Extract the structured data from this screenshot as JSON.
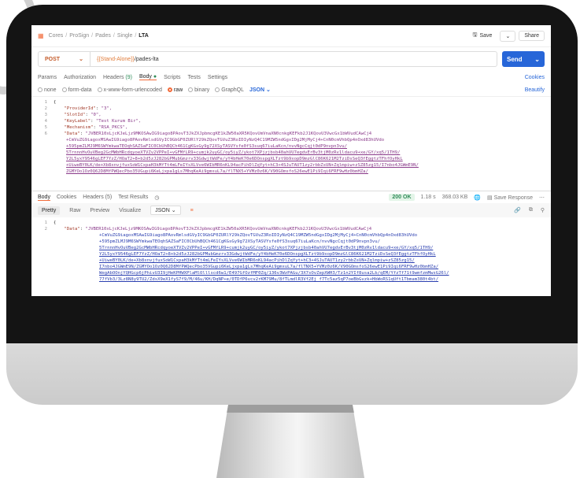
{
  "breadcrumb": [
    "Cores",
    "ProSign",
    "Pades",
    "Single",
    "LTA"
  ],
  "toolbar": {
    "save": "Save",
    "share": "Share"
  },
  "request": {
    "method": "POST",
    "url_var": "{{Stand-Alone}}",
    "url_path": "/pades-lta",
    "send": "Send"
  },
  "tabs": {
    "params": "Params",
    "auth": "Authorization",
    "headers": "Headers",
    "headers_count": "(9)",
    "body": "Body",
    "scripts": "Scripts",
    "tests": "Tests",
    "settings": "Settings",
    "cookies": "Cookies"
  },
  "body_options": {
    "none": "none",
    "form_data": "form-data",
    "urlencoded": "x-www-form-urlencoded",
    "raw": "raw",
    "binary": "binary",
    "graphql": "GraphQL",
    "format": "JSON",
    "beautify": "Beautify"
  },
  "request_lines": [
    {
      "n": "1",
      "t": "{"
    },
    {
      "n": "2",
      "k": "\"ProviderId\"",
      "v": "\"3\","
    },
    {
      "n": "3",
      "k": "\"SlotId\"",
      "v": "\"0\","
    },
    {
      "n": "4",
      "k": "\"KeyLabel\"",
      "v": "\"Test Kurum Bir\","
    },
    {
      "n": "5",
      "k": "\"Mechanism\"",
      "v": "\"RSA_PKCS\","
    },
    {
      "n": "6",
      "k": "\"Data\"",
      "v": "\"JVBER10xLjcKJeLjz9MKOSAwIG9iago8PAovT3JkZXJpbmcgKE1kZW50aXR5KQovUmVnaXN0cnkgKEFkb2J1KQovU3VwcGx1bWVudCAwCj4"
    },
    {
      "n": "",
      "v": "+CmVuZG9iagoxMSAwIG9iago8PAovRmlsdGVyIC9GbGF0ZURlY29kZQovTGVuZ3RoIDIyNzQ4C19MZW5ndGgxIDg2MjMyCj4+CnN0cmVhbQp4nOxd83hUVdo"
    },
    {
      "n": "",
      "v": "+595pmZLMJ9M6SWYmkwaTEOqhSAZSaFIC0CbUhBQCh461CgKGsGy9g72XSyTASVYsfe0fS3suq67iuLaKcn/nvvNgcCqjt0dP9nvpn3vu/"
    },
    {
      "n": "",
      "v": "5TrnnnHvOuVBeg2GcMWbHRcdqyoeXTVZv2VPPeI+vGFMfLR9+cumjk2uyGC/oy5iyZ/ykot7XPjzjbsb40ahVU7egdvErBv3tjM0zRv1ldacu9+xe/GY/xq5/1TH9/"
    },
    {
      "n": "",
      "v": "Y2L5yxY9546gLEF7YzZ/HOaT2+8+b2d5zJ282bGPMubGmzrv33GdwjtWdFe/yY4bHeK70e6DOnspgXLTzt9b9xopD9mzGlC86K621M2TziDsSeQ3fEggtzTFhfOyHkL"
    },
    {
      "n": "",
      "v": "+UiweBY0LK/de+Xb8xnvjfuxSoW1CxpaH3kMfTt4mLFeIYsXLVve6WIbMR6nKL94acPihDlZqYyt+hC3+4SJuTAUT1zy2rbbZsUN+Zqlmpiw+zSZ85zg15/I7nbo4JGWmE9N/"
    },
    {
      "n": "",
      "v": "ZGMYOo1Oz0Q62D8MfPWQecPbo35VGupi6KeLjxpa1gLs7MhqKeAi9gmxuL7a/flTNX5+YVMz0z6K/V90GOmsfoS26ewE1Pi9Iqi6FRF9wHz0bmHZa/"
    }
  ],
  "response_bar": {
    "body": "Body",
    "cookies": "Cookies",
    "headers": "Headers (5)",
    "test_results": "Test Results",
    "status": "200 OK",
    "time": "1.18 s",
    "size": "368.03 KB",
    "save_response": "Save Response"
  },
  "view_bar": {
    "pretty": "Pretty",
    "raw": "Raw",
    "preview": "Preview",
    "visualize": "Visualize",
    "format": "JSON"
  },
  "response_lines": [
    {
      "n": "1",
      "t": "{"
    },
    {
      "n": "2",
      "k": "\"Data\"",
      "v": "\"JVBER10xLjcKJeLjz9MKOSAwIG9iago8PAovT3JkZXJpbmcgKE1kZW50aXR5KQovUmVnaXN0cnkgKEFkb2J1KQovU3VwcGx1bWVudCAwCj4"
    },
    {
      "n": "",
      "v": "+CmVuZG9iagoxMSAwIG9iago8PAovRmlsdGVyIC9GbGF0ZURlY29kZQovTGVuZ3RoIDIyNzQ4C19MZW5ndGgxIDg2MjMyCj4+CnN0cmVhbQp4nOxd83hUVdo"
    },
    {
      "n": "",
      "v": "+595pmZLMJ9M6SWYmkwaTEOqhSAZSaFIC0CbUhBQCh461CgKGsGy9g72XSyTASVYsfe0fS3suq67iuLaKcn/nvvNgcCqjt0dP9nvpn3vu/"
    },
    {
      "n": "",
      "v": "5TrnnnHvOuVBeg2GcMWbHRcdqyoeXTVZv2VPPeI+vGFMfLR9+cumjk2uyGC/oy5iyZ/ykot7XPjzjbsb40ahVU7egdvErBv3tjM0zRv1ldacu9+xe/GY/xq5/1TH9/"
    },
    {
      "n": "",
      "v": "Y2L5yxY9546gLEF7YzZ/HOaT2+8+b2d5zJ282bGPMubGmzrv33GdwjtWdFe/yY4bHeK70e6DOnspgXLTzt9b9xopD9mzGlC86K621M2TziDsSeQ3fEggtzTFhfOyHkL"
    },
    {
      "n": "",
      "v": "+UiweBY0LK/de+Xb8xnvjfuxSoW1CxpaH3kMfTt4mLFeIYsXLVve6WIbMR6nKL94acPihDlZqYyt+hC3+4SJuTAUT1zy2rbbZsUN+Zqlmpiw+zSZ85zg15/"
    },
    {
      "n": "",
      "v": "I7nbo4JGWmE9N/ZGMYOo1Oz0Q62D8MfPWQecPbo35VGupi6KeLjxpa1gLs7MhqKeAi9gmxuL7a/flTNX5+YVMz0z6K/V90GOmsfoS26ewE1Pi9Iqi6FRF9wHz0bmHZa/"
    },
    {
      "n": "",
      "v": "WegAbOOnjYQHGcp6jPhivU3I9jHeKPHWXPlaMlOlllscd6w1/E497GfOzfMF0Zq/136v3WzPAGu/3X7sOvZepXWH3/Tz1n2YIf8usa2Lb/qEM/YfzTf71t9wmfzmMwsG26l/"
    },
    {
      "n": "",
      "v": "77fVb3/3Lz8N8y9TU2/ZdsX9eX1fyS7f9/M/46u/KH/DqNP+e/0TDfP6vcv2rKM79Mu/8fTLmdlR3Vf2Ej f7Tc5az5qP7oeBbGvzk+HbWoRS1qUft1Tbmam380t4bt/"
    }
  ]
}
